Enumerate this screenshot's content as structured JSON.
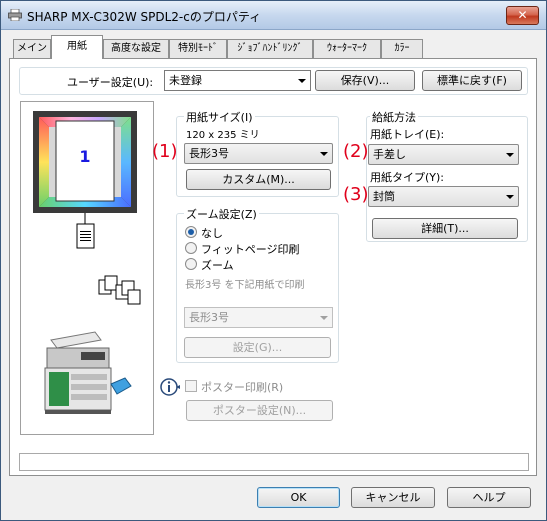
{
  "window": {
    "title": "SHARP MX-C302W SPDL2-cのプロパティ",
    "close_label": "✕"
  },
  "tabs": [
    {
      "label": "メイン"
    },
    {
      "label": "用紙"
    },
    {
      "label": "高度な設定"
    },
    {
      "label": "特別ﾓｰﾄﾞ"
    },
    {
      "label": "ｼﾞｮﾌﾞﾊﾝﾄﾞﾘﾝｸﾞ"
    },
    {
      "label": "ｳｫｰﾀｰﾏｰｸ"
    },
    {
      "label": "ｶﾗｰ"
    }
  ],
  "user_settings": {
    "label": "ユーザー設定(U):",
    "value": "未登録",
    "save_label": "保存(V)...",
    "reset_label": "標準に戻す(F)"
  },
  "preview": {
    "page_number": "1"
  },
  "paper_size": {
    "heading": "用紙サイズ(I)",
    "dimensions": "120 x 235 ミリ",
    "value": "長形3号",
    "custom_label": "カスタム(M)..."
  },
  "zoom": {
    "heading": "ズーム設定(Z)",
    "options": [
      "なし",
      "フィットページ印刷",
      "ズーム"
    ],
    "note": "長形3号 を下記用紙で印刷",
    "select_value": "長形3号",
    "settings_label": "設定(G)..."
  },
  "poster": {
    "checkbox_label": "ポスター印刷(R)",
    "settings_label": "ポスター設定(N)..."
  },
  "paper_source": {
    "heading": "給紙方法",
    "tray_label": "用紙トレイ(E):",
    "tray_value": "手差し",
    "type_label": "用紙タイプ(Y):",
    "type_value": "封筒",
    "detail_label": "詳細(T)..."
  },
  "callouts": [
    "(1)",
    "(2)",
    "(3)"
  ],
  "footer": {
    "ok_label": "OK",
    "cancel_label": "キャンセル",
    "help_label": "ヘルプ"
  }
}
